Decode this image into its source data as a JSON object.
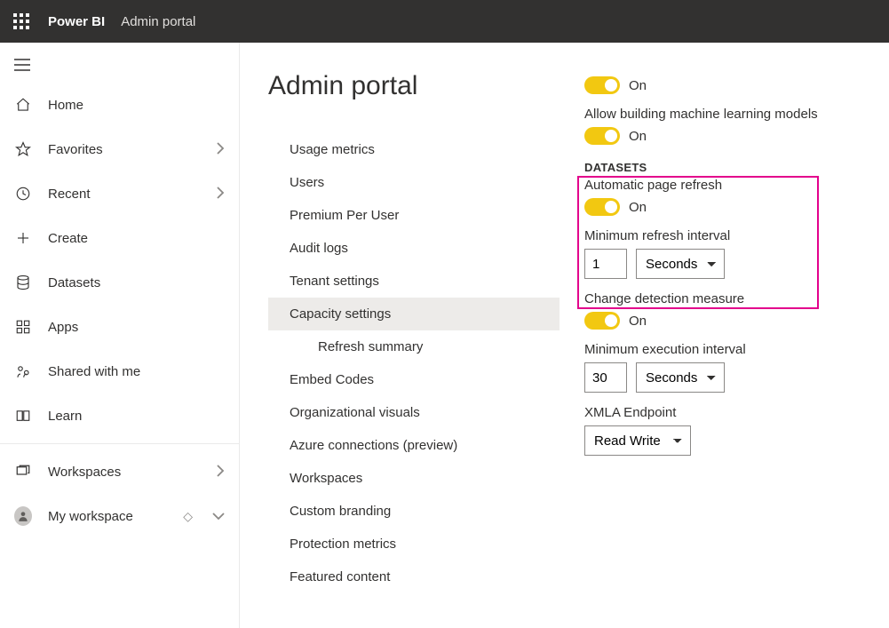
{
  "header": {
    "brand": "Power BI",
    "area": "Admin portal"
  },
  "sidebar": {
    "items": [
      {
        "icon": "home",
        "label": "Home",
        "chevron": false
      },
      {
        "icon": "star",
        "label": "Favorites",
        "chevron": true
      },
      {
        "icon": "clock",
        "label": "Recent",
        "chevron": true
      },
      {
        "icon": "plus",
        "label": "Create",
        "chevron": false
      },
      {
        "icon": "db",
        "label": "Datasets",
        "chevron": false
      },
      {
        "icon": "apps",
        "label": "Apps",
        "chevron": false
      },
      {
        "icon": "share",
        "label": "Shared with me",
        "chevron": false
      },
      {
        "icon": "learn",
        "label": "Learn",
        "chevron": false
      }
    ],
    "workspaces": {
      "icon": "stack",
      "label": "Workspaces",
      "chevron": true
    },
    "myws": {
      "label": "My workspace"
    }
  },
  "page": {
    "title": "Admin portal"
  },
  "menu": {
    "items": [
      "Usage metrics",
      "Users",
      "Premium Per User",
      "Audit logs",
      "Tenant settings",
      "Capacity settings",
      "Embed Codes",
      "Organizational visuals",
      "Azure connections (preview)",
      "Workspaces",
      "Custom branding",
      "Protection metrics",
      "Featured content"
    ],
    "selected_index": 5,
    "sub_of_selected": "Refresh summary"
  },
  "settings": {
    "toggle_on_text": "On",
    "top_toggle_1_state": "On",
    "allow_ml_label": "Allow building machine learning models",
    "top_toggle_2_state": "On",
    "section_datasets": "DATASETS",
    "auto_refresh_label": "Automatic page refresh",
    "auto_refresh_state": "On",
    "min_refresh_label": "Minimum refresh interval",
    "min_refresh_value": "1",
    "min_refresh_unit": "Seconds",
    "change_detect_label": "Change detection measure",
    "change_detect_state": "On",
    "min_exec_label": "Minimum execution interval",
    "min_exec_value": "30",
    "min_exec_unit": "Seconds",
    "xmla_label": "XMLA Endpoint",
    "xmla_value": "Read Write"
  }
}
